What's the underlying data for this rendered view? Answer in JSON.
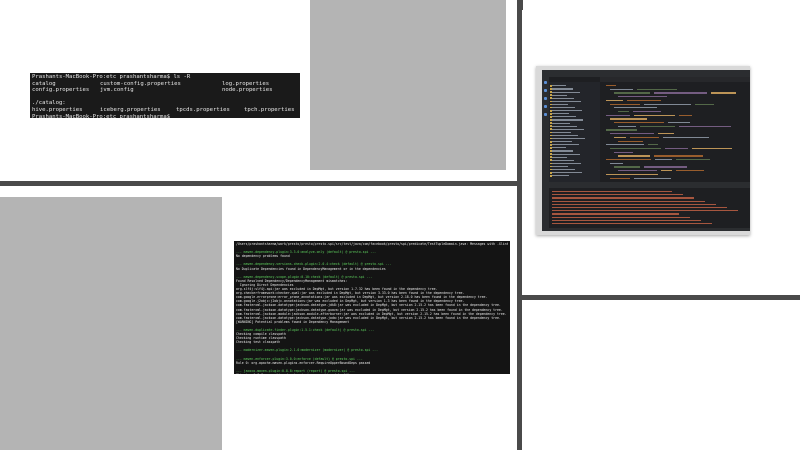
{
  "terminal_top": {
    "rows": [
      [
        "Prashants-MacBook-Pro:etc prashantsharma$ ls -R"
      ],
      [
        "catalog",
        "custom-config.properties",
        "log.properties"
      ],
      [
        "config.properties",
        "jvm.config",
        "node.properties"
      ],
      [
        ""
      ],
      [
        "./catalog:"
      ],
      [
        "hive.properties",
        "iceberg.properties",
        "tpcds.properties",
        "tpch.properties"
      ],
      [
        "Prashants-MacBook-Pro:etc prashantsharma$"
      ]
    ]
  },
  "terminal_maven": {
    "lines": [
      {
        "t": "/Users/prashantsharma/work/presto/presto/presto-spi/src/test/java/com/facebook/presto/spi/predicate/TestTupleDomain.java: Messages with -Xlint:depr",
        "k": "w"
      },
      {
        "t": "",
        "k": "sp"
      },
      {
        "t": "--- maven-dependency-plugin:3.3.0:analyze-only (default) @ presto-spi ---",
        "k": "g"
      },
      {
        "t": "No dependency problems found",
        "k": "w"
      },
      {
        "t": "",
        "k": "sp"
      },
      {
        "t": "--- maven-dependency-versions-check-plugin:2.0.4:check (default) @ presto-spi ---",
        "k": "g"
      },
      {
        "t": "No Duplicate Dependencies found in DependencyManagement or in the dependencies",
        "k": "w"
      },
      {
        "t": "",
        "k": "sp"
      },
      {
        "t": "--- maven-dependency-scope-plugin:0.10:check (default) @ presto-spi ---",
        "k": "g"
      },
      {
        "t": "Found Resolved Dependency/DependencyManagement mismatches:",
        "k": "w"
      },
      {
        "t": "  Ignoring Direct Dependencies",
        "k": "w"
      },
      {
        "t": "org.slf4j:slf4j-api:jar was excluded in DepMgt, but version 1.7.32 has been found in the dependency tree.",
        "k": "w"
      },
      {
        "t": "org.checkerframework:checker-qual:jar was excluded in DepMgt, but version 3.33.0 has been found in the dependency tree.",
        "k": "w"
      },
      {
        "t": "com.google.errorprone:error_prone_annotations:jar was excluded in DepMgt, but version 2.18.0 has been found in the dependency tree.",
        "k": "w"
      },
      {
        "t": "com.google.j2objc:j2objc-annotations:jar was excluded in DepMgt, but version 1.3 has been found in the dependency tree.",
        "k": "w"
      },
      {
        "t": "com.fasterxml.jackson.datatype:jackson-datatype-jdk8:jar was excluded in DepMgt, but version 2.15.2 has been found in the dependency tree.",
        "k": "w"
      },
      {
        "t": "com.fasterxml.jackson.datatype:jackson-datatype-guava:jar was excluded in DepMgt, but version 2.15.2 has been found in the dependency tree.",
        "k": "w"
      },
      {
        "t": "com.fasterxml.jackson.module:jackson-module-afterburner:jar was excluded in DepMgt, but version 2.15.2 has been found in the dependency tree.",
        "k": "w"
      },
      {
        "t": "com.fasterxml.jackson.datatype:jackson-datatype-joda:jar was excluded in DepMgt, but version 2.15.2 has been found in the dependency tree.",
        "k": "w"
      },
      {
        "t": "[WARNING] Potential problems found in Dependency Management",
        "k": "w"
      },
      {
        "t": "",
        "k": "sp"
      },
      {
        "t": "--- maven-duplicate-finder-plugin:1.5.1:check (default) @ presto-spi ---",
        "k": "g"
      },
      {
        "t": "Checking compile classpath",
        "k": "w"
      },
      {
        "t": "Checking runtime classpath",
        "k": "w"
      },
      {
        "t": "Checking test classpath",
        "k": "w"
      },
      {
        "t": "",
        "k": "sp"
      },
      {
        "t": "--- modernizer-maven-plugin:2.1.0:modernizer (modernizer) @ presto-spi ---",
        "k": "g"
      },
      {
        "t": "",
        "k": "sp"
      },
      {
        "t": "--- maven-enforcer-plugin:3.0.0:enforce (default) @ presto-spi ---",
        "k": "g"
      },
      {
        "t": "Rule 0: org.apache.maven.plugins.enforcer.RequireUpperBoundDeps passed",
        "k": "w"
      },
      {
        "t": "",
        "k": "sp"
      },
      {
        "t": "--- jacoco-maven-plugin:0.8.8:report (report) @ presto-spi ---",
        "k": "g"
      },
      {
        "t": "Skipping JaCoCo execution due to missing execution data file.",
        "k": "w"
      },
      {
        "t": "",
        "k": "sp"
      },
      {
        "t": "--- maven-jar-plugin:3.3.0:jar (default-jar) @ presto-spi ---",
        "k": "g"
      },
      {
        "t": "Building jar: /Users/prashantsharma/work/presto/presto/presto-spi/target/presto-spi-0.290-SNAPSHOT.jar",
        "k": "w"
      }
    ]
  },
  "ide_icons": [
    "project-icon",
    "run-icon",
    "debug-icon",
    "terminal-icon",
    "git-icon"
  ],
  "colors": {
    "divider": "#4a4a4a",
    "gray_panel": "#b4b4b4",
    "terminal_bg": "#1a1a1a",
    "maven_green": "#5fd35f",
    "ide_bg": "#1e1f22"
  }
}
